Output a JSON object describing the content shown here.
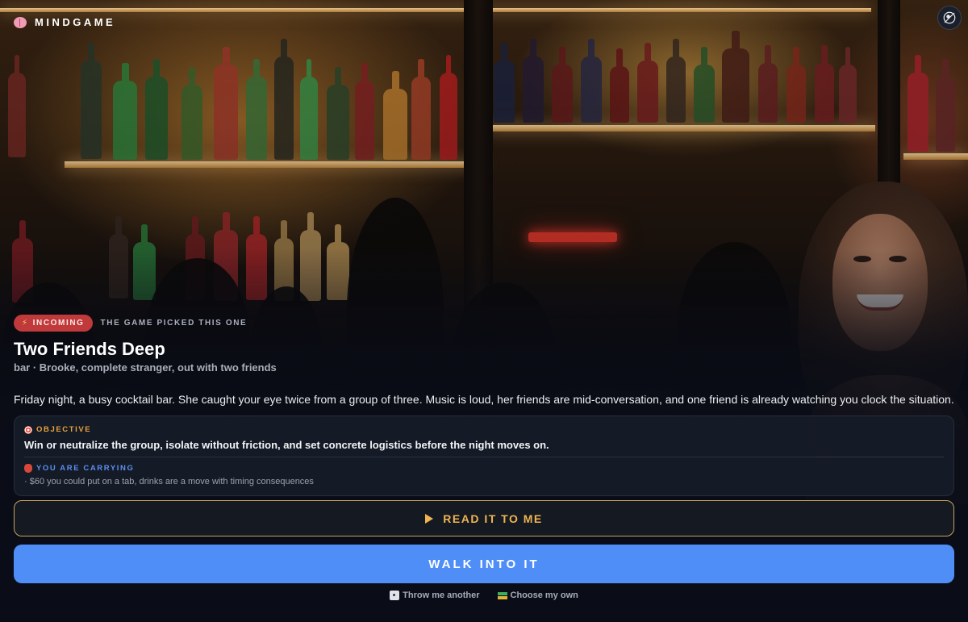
{
  "app": {
    "brand": "MINDGAME",
    "brand_icon": "brain-icon",
    "profile_icon": "settings-avatar-icon"
  },
  "scenario": {
    "badge": "INCOMING",
    "badge_icon": "lightning-icon",
    "picked_note": "THE GAME PICKED THIS ONE",
    "title": "Two Friends Deep",
    "subtitle": "bar · Brooke, complete stranger, out with two friends",
    "premise": "Friday night, a busy cocktail bar. She caught your eye twice from a group of three. Music is loud, her friends are mid-conversation, and one friend is already watching you clock the situation."
  },
  "brief": {
    "objective_label": "OBJECTIVE",
    "objective_icon": "target-icon",
    "objective_text": "Win or neutralize the group, isolate without friction, and set concrete logistics before the night moves on.",
    "carrying_label": "YOU ARE CARRYING",
    "carrying_icon": "bag-icon",
    "carrying_text": "· $60 you could put on a tab, drinks are a move with timing consequences"
  },
  "actions": {
    "read_label": "READ IT TO ME",
    "read_icon": "play-icon",
    "walk_label": "WALK INTO IT",
    "throw_label": "Throw me another",
    "throw_icon": "dice-icon",
    "choose_label": "Choose my own",
    "choose_icon": "books-icon"
  },
  "colors": {
    "accent_blue": "#4f8ef7",
    "accent_gold": "#f0b550",
    "badge_red": "#c0393b",
    "background": "#0a0d18"
  }
}
